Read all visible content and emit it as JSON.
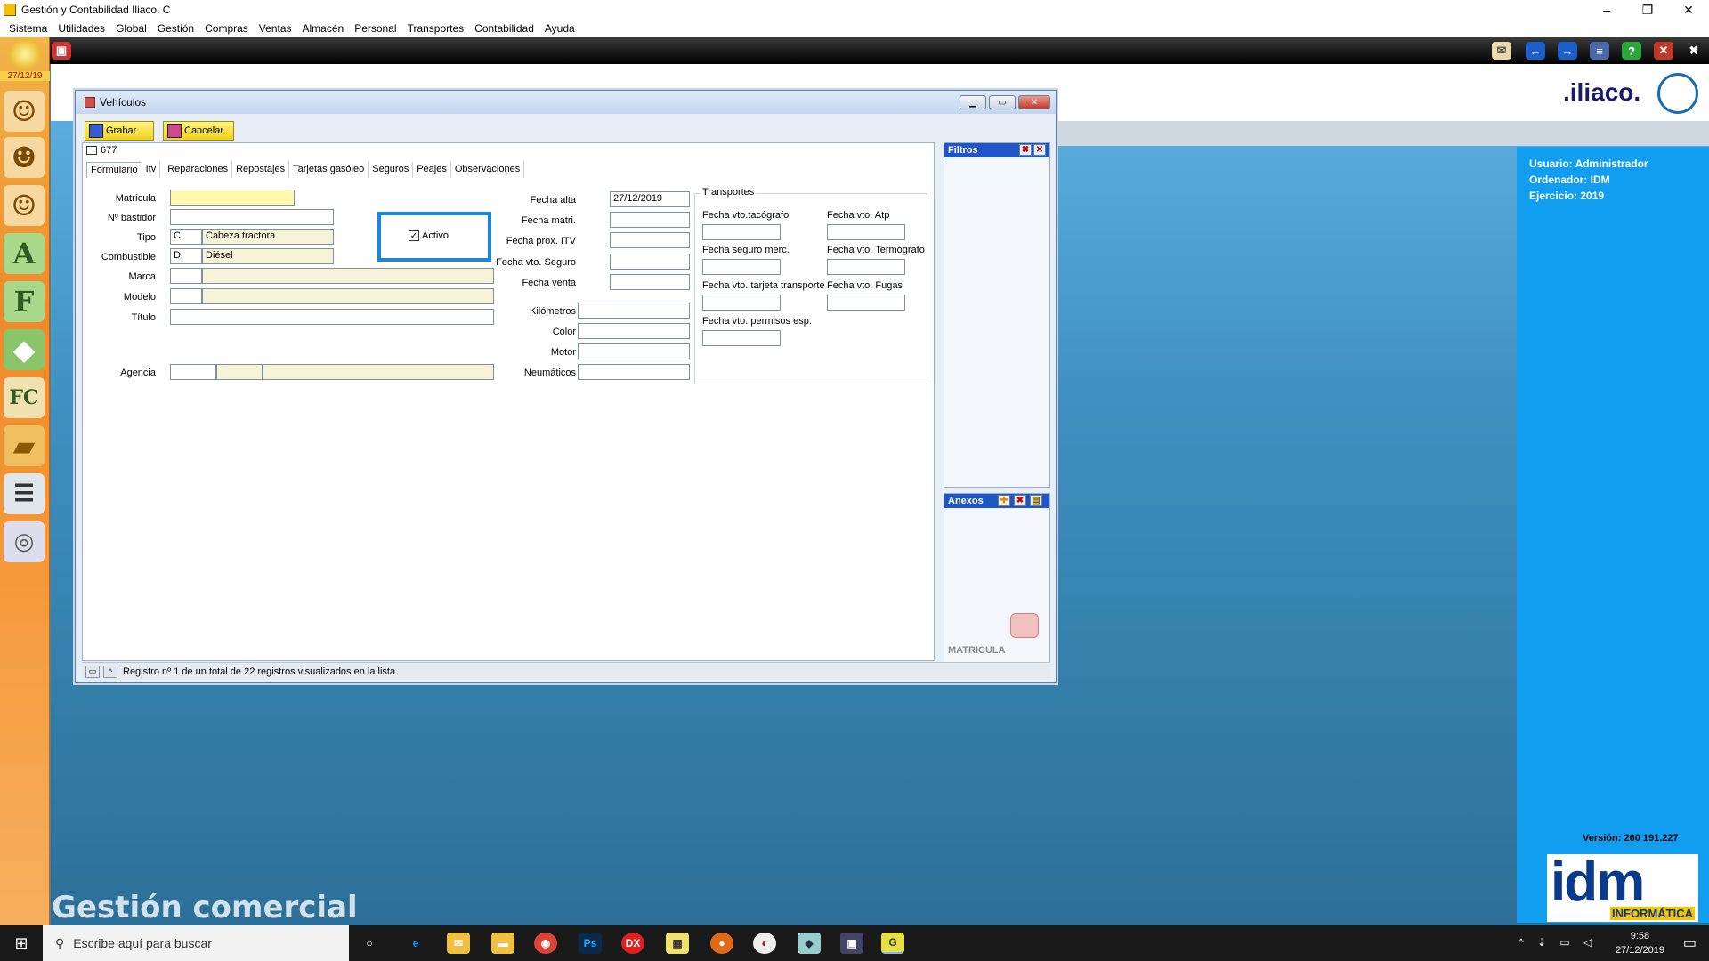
{
  "app": {
    "title": "Gestión y Contabilidad Iliaco. C"
  },
  "menu": [
    "Sistema",
    "Utilidades",
    "Global",
    "Gestión",
    "Compras",
    "Ventas",
    "Almacén",
    "Personal",
    "Transportes",
    "Contabilidad",
    "Ayuda"
  ],
  "sidebar": {
    "date": "27/12/19"
  },
  "brand": {
    "iliaco": ".iliaco.",
    "gestion": "Gestión comercial",
    "idm": "idm",
    "idm_sub": "INFORMÁTICA",
    "version": "Versión: 260 191.227"
  },
  "info": {
    "usuario": "Usuario: Administrador",
    "ordenador": "Ordenador:  IDM",
    "ejercicio": "Ejercicio: 2019"
  },
  "window": {
    "title": "Vehículos",
    "save_label": "Grabar",
    "cancel_label": "Cancelar",
    "record_no": "677",
    "tabs": [
      "Formulario",
      "Itv",
      "Reparaciones",
      "Repostajes",
      "Tarjetas gasóleo",
      "Seguros",
      "Peajes",
      "Observaciones"
    ],
    "status": "Registro nº 1 de un total de 22 registros visualizados en la lista."
  },
  "form": {
    "matricula_label": "Matrícula",
    "matricula": "",
    "bastidor_label": "Nº bastidor",
    "bastidor": "",
    "tipo_label": "Tipo",
    "tipo_code": "C",
    "tipo_desc": "Cabeza tractora",
    "combustible_label": "Combustible",
    "combustible_code": "D",
    "combustible_desc": "Diésel",
    "marca_label": "Marca",
    "modelo_label": "Modelo",
    "titulo_label": "Título",
    "agencia_label": "Agencia",
    "activo_label": "Activo",
    "activo_checked": true,
    "fecha_alta_label": "Fecha alta",
    "fecha_alta": "27/12/2019",
    "fecha_matri_label": "Fecha matri.",
    "fecha_itv_label": "Fecha prox. ITV",
    "fecha_seguro_label": "Fecha vto. Seguro",
    "fecha_venta_label": "Fecha venta",
    "km_label": "Kilómetros",
    "color_label": "Color",
    "motor_label": "Motor",
    "neumaticos_label": "Neumáticos"
  },
  "transportes": {
    "legend": "Transportes",
    "tacografo": "Fecha vto.tacógrafo",
    "atp": "Fecha vto. Atp",
    "seguro_merc": "Fecha seguro merc.",
    "termografo": "Fecha vto. Termógrafo",
    "tarjeta": "Fecha vto. tarjeta transporte",
    "fugas": "Fecha vto. Fugas",
    "permisos": "Fecha vto. permisos esp."
  },
  "panels": {
    "filtros": "Filtros",
    "anexos": "Anexos",
    "matricula_tag": "MATRICULA"
  },
  "taskbar": {
    "search_placeholder": "Escribe aquí para buscar",
    "time": "9:58",
    "date": "27/12/2019"
  }
}
